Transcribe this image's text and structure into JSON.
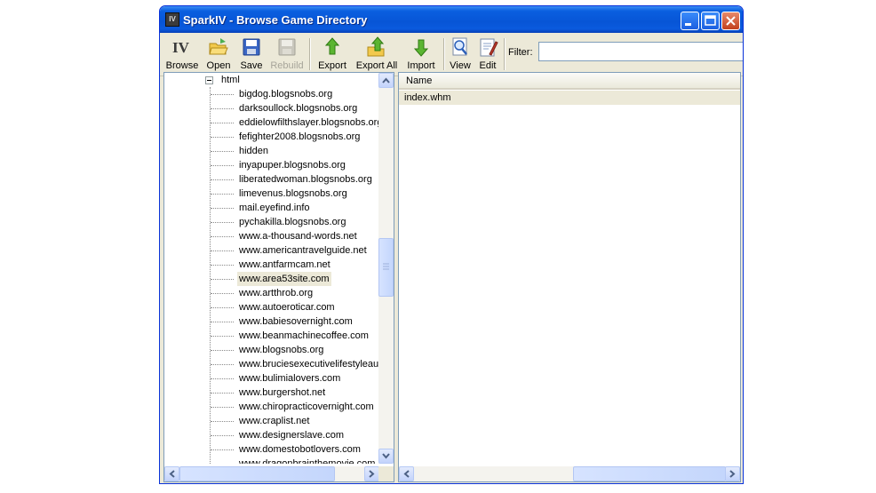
{
  "window": {
    "title": "SparkIV - Browse Game Directory",
    "app_icon_text": "IV"
  },
  "toolbar": {
    "buttons": [
      {
        "label": "Browse",
        "icon": "iv-logo-icon",
        "enabled": true
      },
      {
        "label": "Open",
        "icon": "open-folder-icon",
        "enabled": true
      },
      {
        "label": "Save",
        "icon": "floppy-disk-icon",
        "enabled": true
      },
      {
        "label": "Rebuild",
        "icon": "rebuild-disk-icon",
        "enabled": false
      },
      {
        "label": "Export",
        "icon": "export-arrow-icon",
        "enabled": true
      },
      {
        "label": "Export All",
        "icon": "export-all-icon",
        "enabled": true
      },
      {
        "label": "Import",
        "icon": "import-arrow-icon",
        "enabled": true
      },
      {
        "label": "View",
        "icon": "magnifier-icon",
        "enabled": true
      },
      {
        "label": "Edit",
        "icon": "edit-document-icon",
        "enabled": true
      }
    ],
    "filter_label": "Filter:",
    "filter_value": ""
  },
  "tree": {
    "parent": "html",
    "items": [
      "bigdog.blogsnobs.org",
      "darksoullock.blogsnobs.org",
      "eddielowfilthslayer.blogsnobs.org",
      "fefighter2008.blogsnobs.org",
      "hidden",
      "inyapuper.blogsnobs.org",
      "liberatedwoman.blogsnobs.org",
      "limevenus.blogsnobs.org",
      "mail.eyefind.info",
      "pychakilla.blogsnobs.org",
      "www.a-thousand-words.net",
      "www.americantravelguide.net",
      "www.antfarmcam.net",
      "www.area53site.com",
      "www.artthrob.org",
      "www.autoeroticar.com",
      "www.babiesovernight.com",
      "www.beanmachinecoffee.com",
      "www.blogsnobs.org",
      "www.bruciesexecutivelifestyleaut",
      "www.bulimialovers.com",
      "www.burgershot.net",
      "www.chiropracticovernight.com",
      "www.craplist.net",
      "www.designerslave.com",
      "www.domestobotlovers.com",
      "www.dragonbrainthemovie.com"
    ],
    "selected": "www.area53site.com"
  },
  "list": {
    "column_name": "Name",
    "rows": [
      "index.whm"
    ]
  },
  "colors": {
    "titlebar": "#0755d6",
    "window_bg": "#ece9d8",
    "selection": "#ece9d8"
  }
}
